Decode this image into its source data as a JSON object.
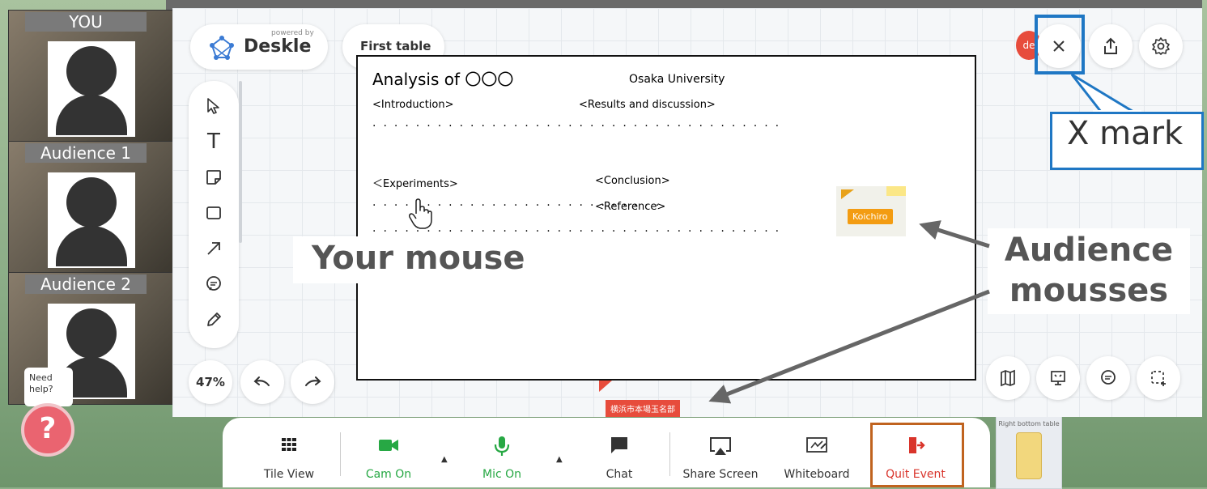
{
  "participants": [
    {
      "name": "YOU"
    },
    {
      "name": "Audience 1"
    },
    {
      "name": "Audience 2"
    }
  ],
  "board": {
    "logo_powered_by": "powered by",
    "logo_brand": "Deskle",
    "table_name": "First table",
    "zoom": "47%",
    "top_user_initials": "de",
    "right_table_label": "Right bottom table"
  },
  "document": {
    "title": "Analysis of 〇〇〇",
    "university": "Osaka University",
    "introduction": "<Introduction>",
    "results": "<Results and discussion>",
    "dots_long": "······································",
    "experiments": "＜Experiments>",
    "conclusion": "<Conclusion>",
    "dots_short": "···························",
    "reference": "<Reference>"
  },
  "cursors": {
    "audience_1_label": "Koichiro",
    "audience_2_label": "横浜市本場玉名部"
  },
  "annotations": {
    "your_mouse": "Your mouse",
    "x_mark": "X mark",
    "audience_mouses_line1": "Audience",
    "audience_mouses_line2": "mousses"
  },
  "help": {
    "bubble_text": "Need help?",
    "button_glyph": "?"
  },
  "meeting_bar": {
    "tile_view": "Tile View",
    "cam_on": "Cam On",
    "mic_on": "Mic On",
    "chat": "Chat",
    "share_screen": "Share Screen",
    "whiteboard": "Whiteboard",
    "quit_event": "Quit Event"
  },
  "icons": {
    "select": "cursor-arrow-icon",
    "text": "text-icon",
    "sticky": "sticky-note-icon",
    "rectangle": "rectangle-icon",
    "arrow": "arrow-icon",
    "comment": "comment-icon",
    "pen": "pen-icon"
  },
  "colors": {
    "highlight_blue": "#1f77c4",
    "highlight_orange": "#c0631f",
    "cam_mic_green": "#27a844",
    "quit_red": "#d9342b"
  }
}
